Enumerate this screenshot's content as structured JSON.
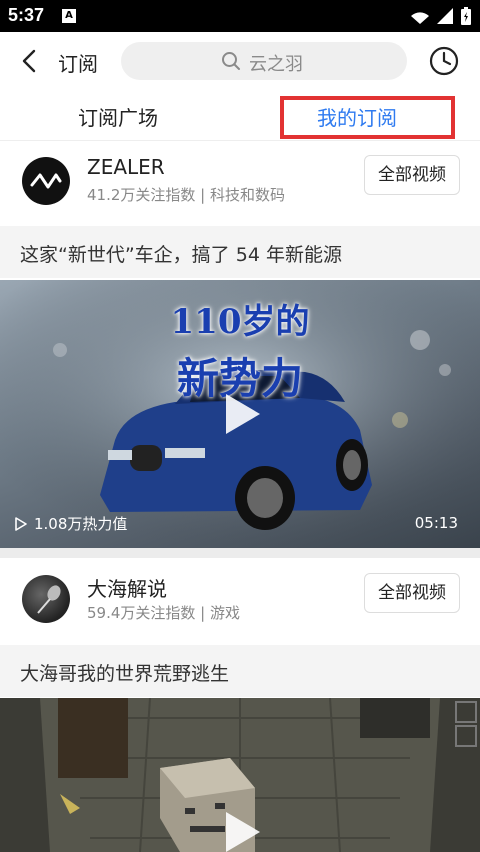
{
  "status": {
    "time": "5:37"
  },
  "header": {
    "title": "订阅",
    "search_placeholder": "云之羽"
  },
  "tabs": [
    {
      "label": "订阅广场"
    },
    {
      "label": "我的订阅"
    }
  ],
  "feed": [
    {
      "channel": {
        "name": "ZEALER",
        "meta": "41.2万关注指数 | 科技和数码",
        "button": "全部视频"
      },
      "video": {
        "title": "这家“新世代”车企，搞了 54 年新能源",
        "overlay_line1": "110岁的",
        "overlay_line2": "新势力",
        "heat": "1.08万热力值",
        "duration": "05:13"
      }
    },
    {
      "channel": {
        "name": "大海解说",
        "meta": "59.4万关注指数 | 游戏",
        "button": "全部视频"
      },
      "video": {
        "title": "大海哥我的世界荒野逃生"
      }
    }
  ],
  "colors": {
    "accent": "#2f7bf0",
    "highlight": "#e23232"
  }
}
